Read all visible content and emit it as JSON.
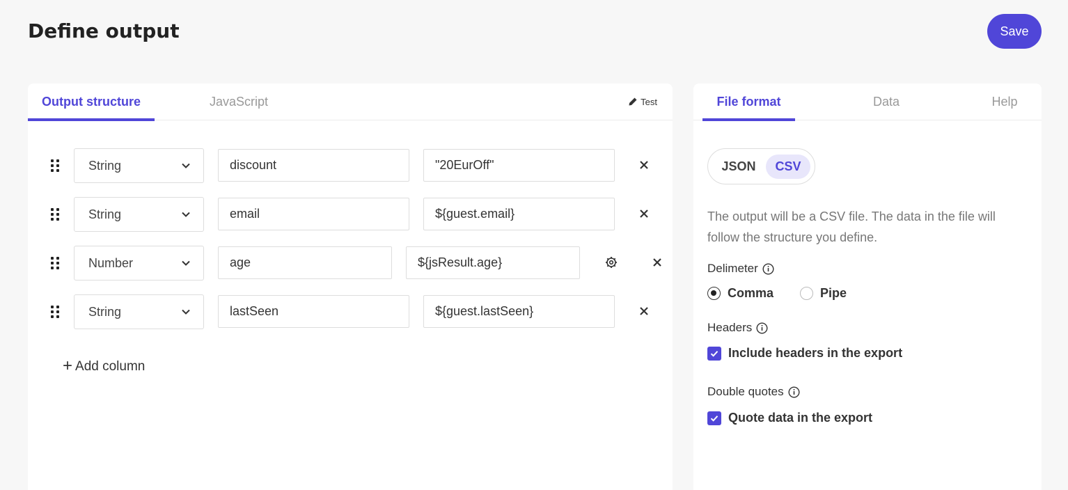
{
  "header": {
    "title": "Define output",
    "save_label": "Save"
  },
  "left_panel": {
    "tabs": [
      {
        "label": "Output structure",
        "active": true
      },
      {
        "label": "JavaScript",
        "active": false
      }
    ],
    "test_label": "Test",
    "columns": [
      {
        "type": "String",
        "name": "discount",
        "value": "\"20EurOff\"",
        "has_settings": false
      },
      {
        "type": "String",
        "name": "email",
        "value": "${guest.email}",
        "has_settings": false
      },
      {
        "type": "Number",
        "name": "age",
        "value": "${jsResult.age}",
        "has_settings": true
      },
      {
        "type": "String",
        "name": "lastSeen",
        "value": "${guest.lastSeen}",
        "has_settings": false
      }
    ],
    "add_column_label": "Add column"
  },
  "right_panel": {
    "tabs": [
      {
        "label": "File format",
        "active": true
      },
      {
        "label": "Data",
        "active": false
      },
      {
        "label": "Help",
        "active": false
      }
    ],
    "format_options": [
      "JSON",
      "CSV"
    ],
    "selected_format": "CSV",
    "description": "The output will be a CSV file. The data in the file will follow the structure you define.",
    "delimiter": {
      "label": "Delimeter",
      "options": [
        "Comma",
        "Pipe"
      ],
      "selected": "Comma"
    },
    "headers": {
      "label": "Headers",
      "checkbox_label": "Include headers in the export",
      "checked": true
    },
    "double_quotes": {
      "label": "Double quotes",
      "checkbox_label": "Quote data in the export",
      "checked": true
    }
  },
  "colors": {
    "accent": "#5046d8",
    "accent_light": "#e8e6fb",
    "background": "#f7f7f7"
  }
}
